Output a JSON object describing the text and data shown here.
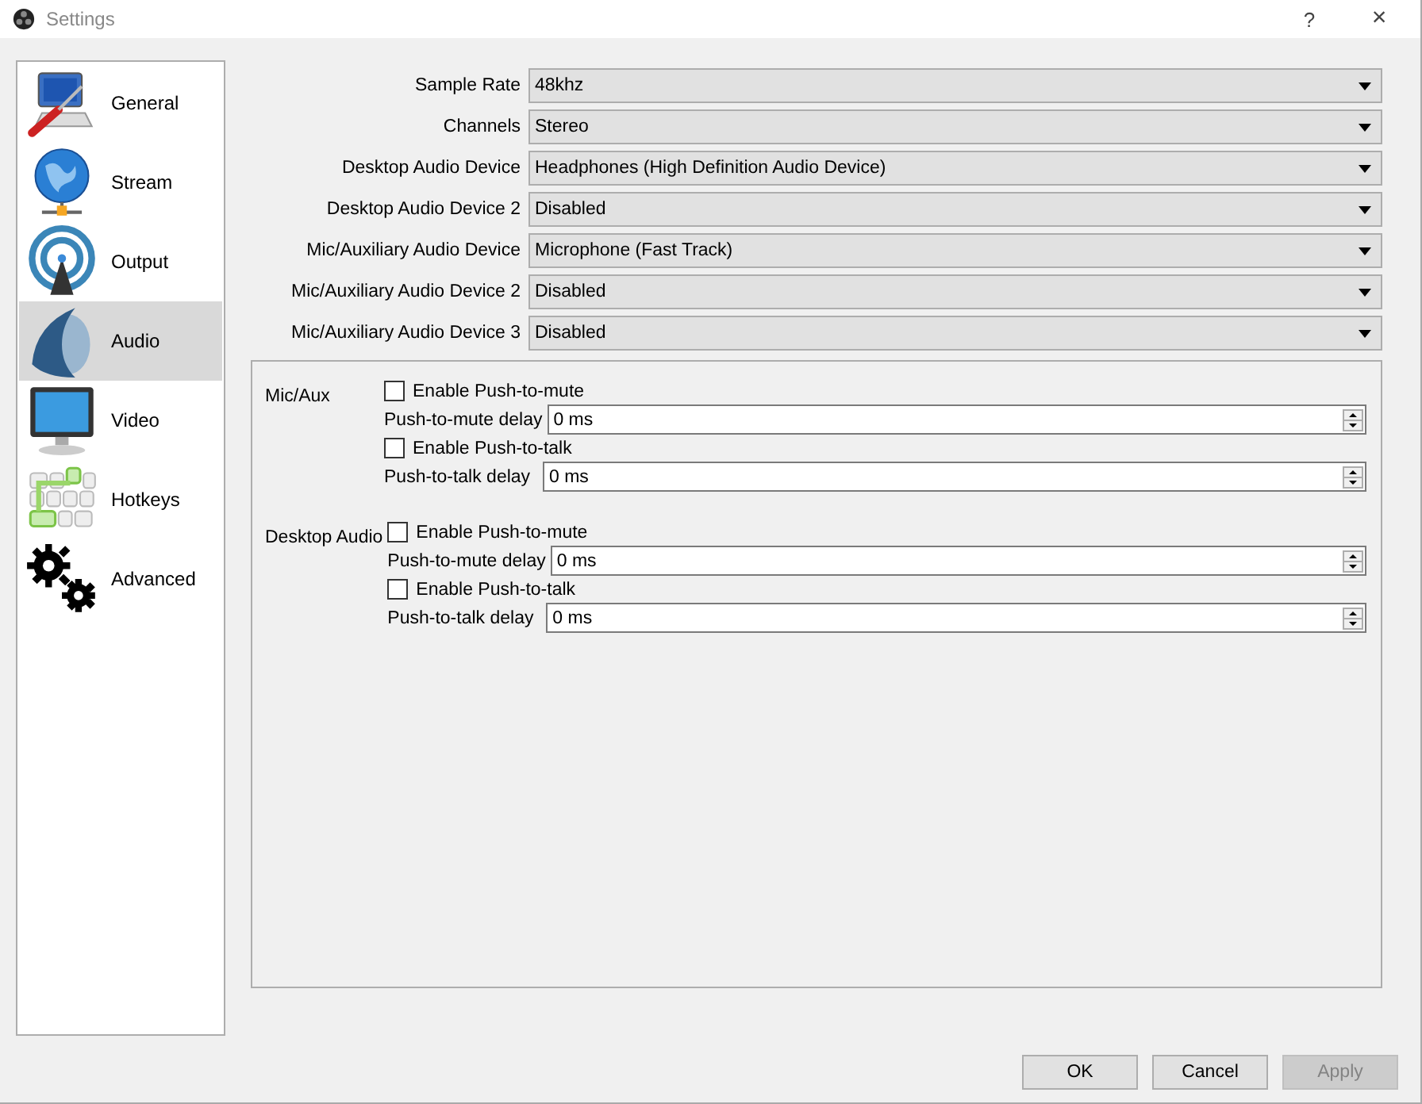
{
  "window": {
    "title": "Settings",
    "help": "?",
    "close": "×"
  },
  "sidebar": {
    "items": [
      {
        "label": "General",
        "selected": false
      },
      {
        "label": "Stream",
        "selected": false
      },
      {
        "label": "Output",
        "selected": false
      },
      {
        "label": "Audio",
        "selected": true
      },
      {
        "label": "Video",
        "selected": false
      },
      {
        "label": "Hotkeys",
        "selected": false
      },
      {
        "label": "Advanced",
        "selected": false
      }
    ]
  },
  "dropdowns": [
    {
      "label": "Sample Rate",
      "value": "48khz"
    },
    {
      "label": "Channels",
      "value": "Stereo"
    },
    {
      "label": "Desktop Audio Device",
      "value": "Headphones (High Definition Audio Device)"
    },
    {
      "label": "Desktop Audio Device 2",
      "value": "Disabled"
    },
    {
      "label": "Mic/Auxiliary Audio Device",
      "value": "Microphone (Fast Track)"
    },
    {
      "label": "Mic/Auxiliary Audio Device 2",
      "value": "Disabled"
    },
    {
      "label": "Mic/Auxiliary Audio Device 3",
      "value": "Disabled"
    }
  ],
  "hotkey_groups": [
    {
      "label": "Mic/Aux",
      "rows": [
        {
          "kind": "checkbox",
          "label": "Enable Push-to-mute",
          "checked": false
        },
        {
          "kind": "spin",
          "label": "Push-to-mute delay",
          "value": "0 ms"
        },
        {
          "kind": "checkbox",
          "label": "Enable Push-to-talk",
          "checked": false
        },
        {
          "kind": "spin",
          "label": "Push-to-talk delay",
          "value": "0 ms"
        }
      ]
    },
    {
      "label": "Desktop Audio",
      "rows": [
        {
          "kind": "checkbox",
          "label": "Enable Push-to-mute",
          "checked": false
        },
        {
          "kind": "spin",
          "label": "Push-to-mute delay",
          "value": "0 ms"
        },
        {
          "kind": "checkbox",
          "label": "Enable Push-to-talk",
          "checked": false
        },
        {
          "kind": "spin",
          "label": "Push-to-talk delay",
          "value": "0 ms"
        }
      ]
    }
  ],
  "buttons": [
    {
      "label": "OK",
      "disabled": false
    },
    {
      "label": "Cancel",
      "disabled": false
    },
    {
      "label": "Apply",
      "disabled": true
    }
  ]
}
